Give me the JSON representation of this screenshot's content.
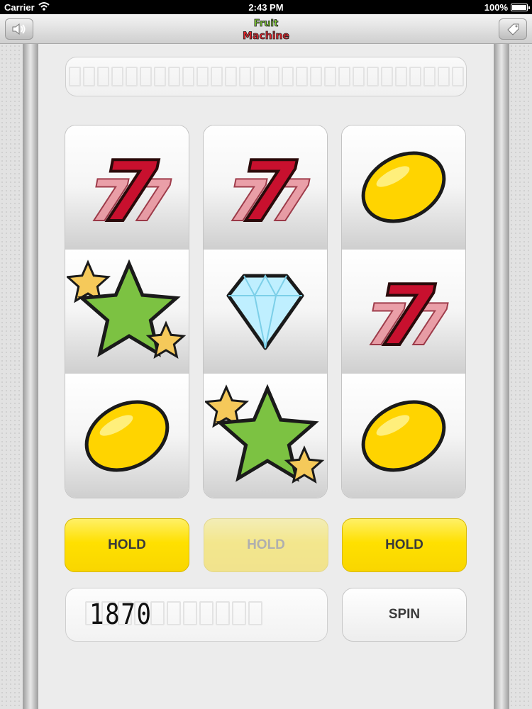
{
  "status_bar": {
    "carrier": "Carrier",
    "time": "2:43 PM",
    "battery": "100%"
  },
  "nav": {
    "left_icon": "speaker-icon",
    "right_icon": "price-tag-icon",
    "logo_line1": "Fruit",
    "logo_line2": "Machine"
  },
  "reels": [
    [
      "seven",
      "star",
      "lemon"
    ],
    [
      "seven",
      "diamond",
      "star"
    ],
    [
      "lemon",
      "seven",
      "lemon"
    ]
  ],
  "hold_buttons": [
    {
      "label": "HOLD",
      "active": true
    },
    {
      "label": "HOLD",
      "active": false
    },
    {
      "label": "HOLD",
      "active": true
    }
  ],
  "credit": "1870",
  "spin_label": "SPIN",
  "colors": {
    "hold_yellow": "#ffe000",
    "seven_red": "#c8102e",
    "star_green": "#7cc242",
    "lemon_yellow": "#ffd400",
    "diamond_blue": "#bfefff"
  }
}
